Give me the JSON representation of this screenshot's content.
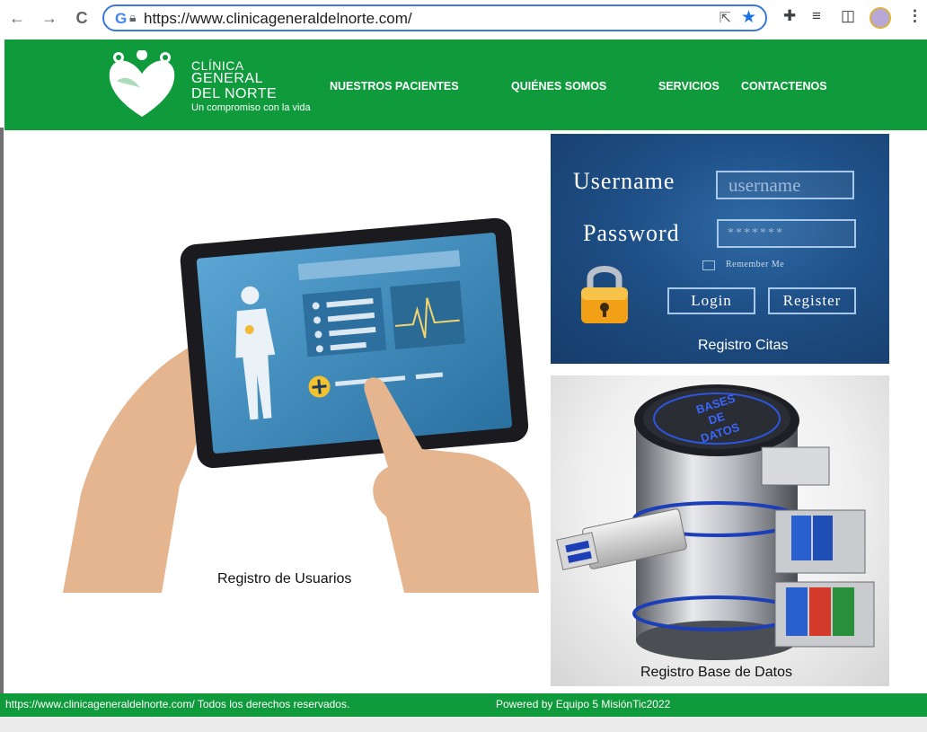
{
  "browser": {
    "url": "https://www.clinicageneraldelnorte.com/",
    "back_icon": "←",
    "forward_icon": "→",
    "reload_icon": "C"
  },
  "brand": {
    "line1": "CLÍNICA",
    "line2": "GENERAL",
    "line3": "DEL NORTE",
    "tagline": "Un compromiso con la vida"
  },
  "menu": [
    "NUESTROS PACIENTES",
    "QUIÉNES SOMOS",
    "SERVICIOS",
    "CONTACTENOS"
  ],
  "cards": {
    "users_caption": "Registro de Usuarios",
    "login": {
      "username_label": "Username",
      "username_placeholder": "username",
      "password_label": "Password",
      "password_value": "*******",
      "remember": "Remember Me",
      "login_btn": "Login",
      "register_btn": "Register",
      "caption": "Registro Citas"
    },
    "db": {
      "caption": "Registro Base de Datos",
      "label_lines": [
        "BASES",
        "DE",
        "DATOS"
      ]
    }
  },
  "footer": {
    "left": "https://www.clinicageneraldelnorte.com/ Todos los derechos reservados.",
    "right": "Powered by Equipo 5 MisiónTic2022"
  },
  "colors": {
    "header_green": "#0f9a3c",
    "login_blue": "#1e4f86",
    "link_blue": "#1a73e8"
  }
}
